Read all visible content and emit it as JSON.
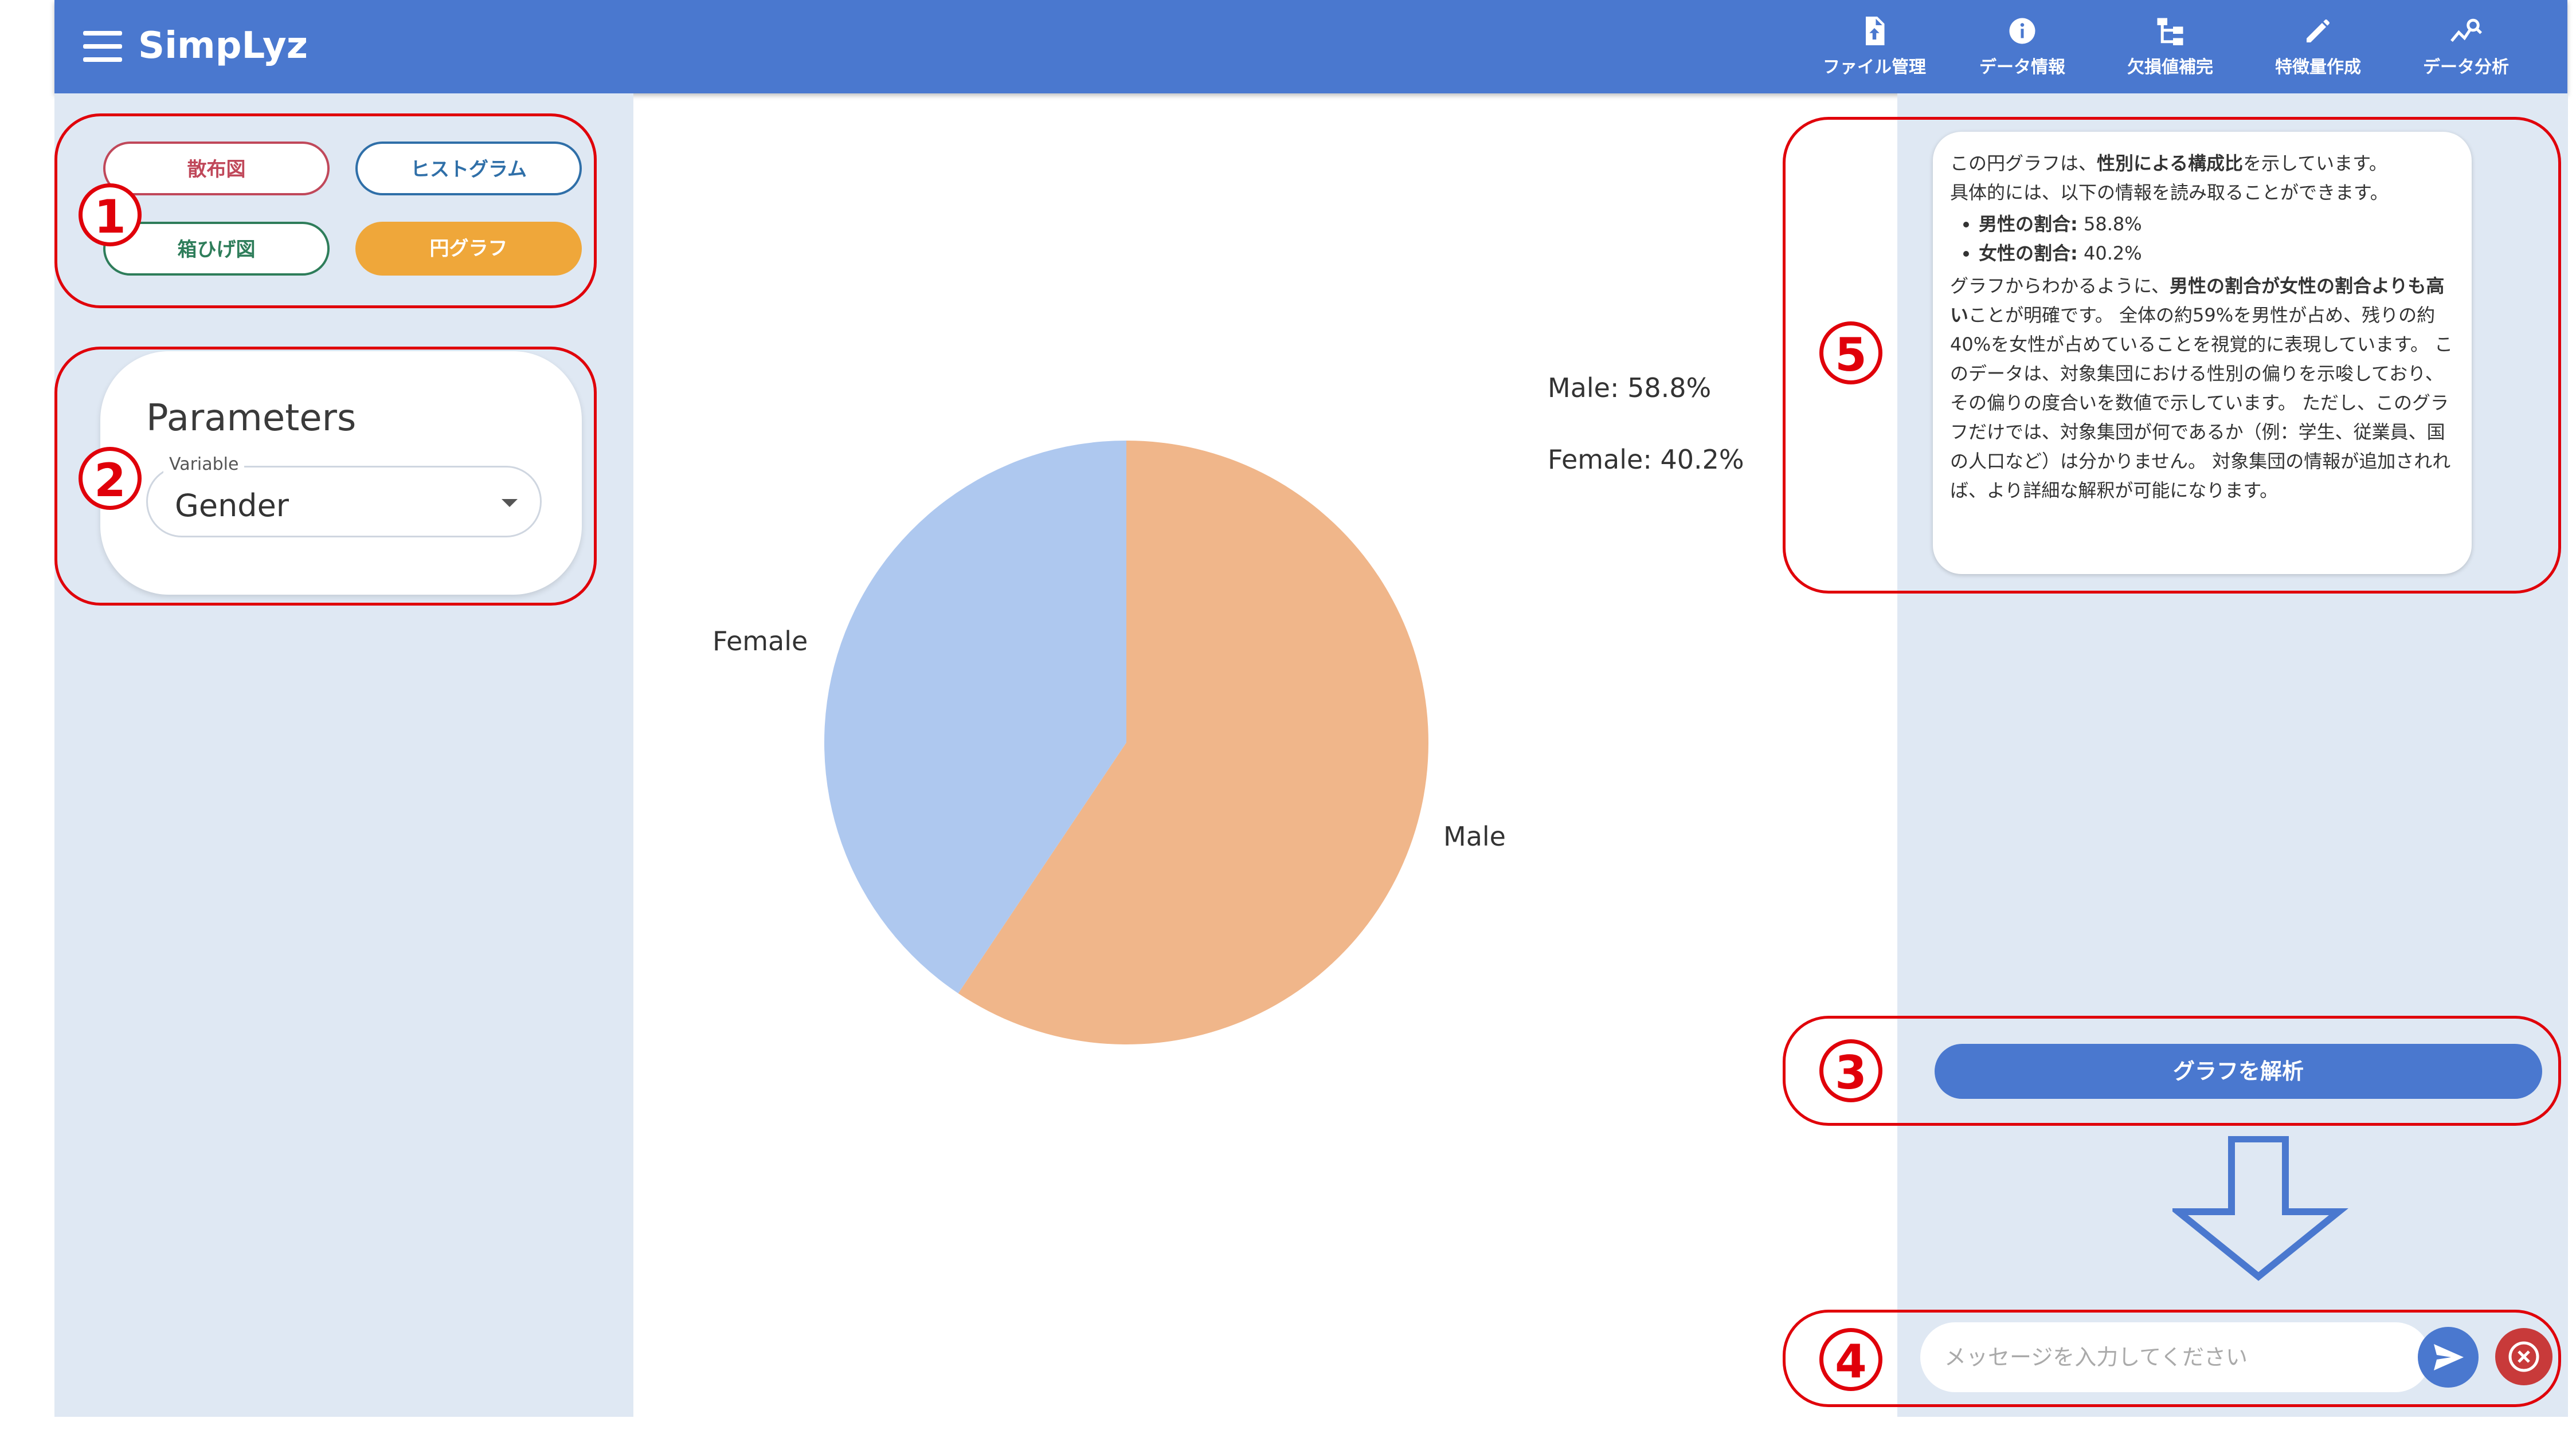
{
  "app": {
    "title": "SimpLyz"
  },
  "nav": [
    {
      "label": "ファイル管理",
      "icon": "file-upload-icon"
    },
    {
      "label": "データ情報",
      "icon": "info-icon"
    },
    {
      "label": "欠損値補完",
      "icon": "tree-structure-icon"
    },
    {
      "label": "特徴量作成",
      "icon": "pencil-icon"
    },
    {
      "label": "データ分析",
      "icon": "analytics-icon"
    }
  ],
  "graph_types": {
    "scatter": "散布図",
    "histogram": "ヒストグラム",
    "boxplot": "箱ひげ図",
    "pie": "円グラフ",
    "selected": "円グラフ"
  },
  "parameters": {
    "title": "Parameters",
    "variable_label": "Variable",
    "variable_value": "Gender"
  },
  "chart_data": {
    "type": "pie",
    "categories": [
      "Male",
      "Female"
    ],
    "values": [
      58.8,
      40.2
    ],
    "colors": [
      "#F0B68A",
      "#AEC8EF"
    ],
    "legend_entries": [
      "Male: 58.8%",
      "Female: 40.2%"
    ],
    "legend_position": "top-right"
  },
  "analysis": {
    "p1_a": "この円グラフは、",
    "p1_b": "性別による構成比",
    "p1_c": "を示しています。",
    "p2": "具体的には、以下の情報を読み取ることができます。",
    "b1_label": "男性の割合:",
    "b1_value": " 58.8%",
    "b2_label": "女性の割合:",
    "b2_value": " 40.2%",
    "p3_a": "グラフからわかるように、",
    "p3_b": "男性の割合が女性の割合よりも高い",
    "p3_c": "ことが明確です。 全体の約59%を男性が占め、残りの約40%を女性が占めていることを視覚的に表現しています。 このデータは、対象集団における性別の偏りを示唆しており、その偏りの度合いを数値で示しています。 ただし、このグラフだけでは、対象集団が何であるか（例：学生、従業員、国の人口など）は分かりません。 対象集団の情報が追加されれば、より詳細な解釈が可能になります。"
  },
  "actions": {
    "analyze_label": "グラフを解析",
    "message_placeholder": "メッセージを入力してください"
  },
  "annotations": {
    "n1": "1",
    "n2": "2",
    "n3": "3",
    "n4": "4",
    "n5": "5",
    "accent": "#E0000A"
  }
}
